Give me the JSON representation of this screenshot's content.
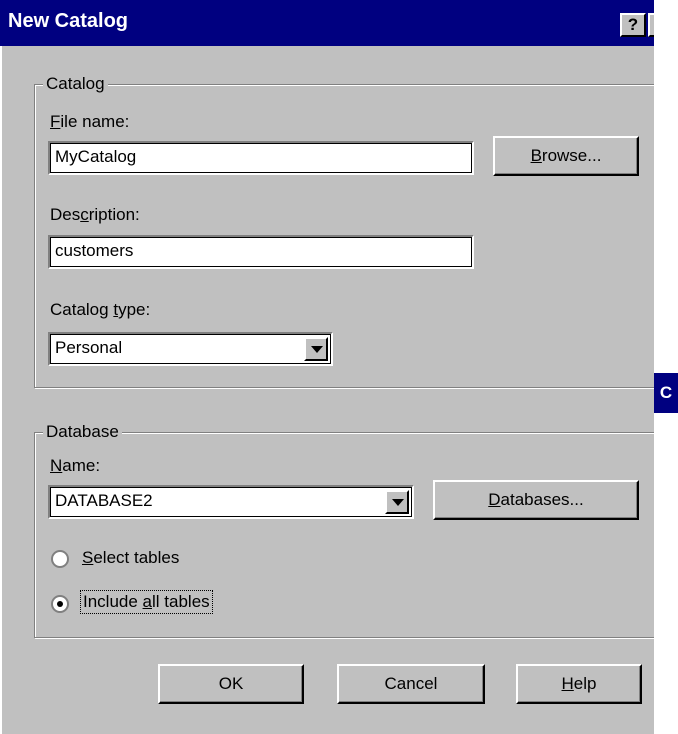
{
  "window": {
    "title": "New Catalog",
    "help_icon_glyph": "?",
    "close_icon_glyph": "✕"
  },
  "catalog_group": {
    "legend": "Catalog",
    "file_name_label": {
      "mnemonic": "F",
      "rest": "ile name:"
    },
    "file_name_value": "MyCatalog",
    "browse_button": {
      "mnemonic": "B",
      "rest": "rowse..."
    },
    "description_label": {
      "pre": "Des",
      "mnemonic": "c",
      "rest": "ription:"
    },
    "description_value": "customers",
    "catalog_type_label": {
      "pre": "Catalog ",
      "mnemonic": "t",
      "rest": "ype:"
    },
    "catalog_type_value": "Personal"
  },
  "database_group": {
    "legend": "Database",
    "name_label": {
      "mnemonic": "N",
      "rest": "ame:"
    },
    "name_value": "DATABASE2",
    "databases_button": {
      "mnemonic": "D",
      "rest": "atabases..."
    },
    "radio_select_tables": {
      "mnemonic": "S",
      "rest": "elect tables",
      "selected": false
    },
    "radio_include_all": {
      "pre": "Include ",
      "mnemonic": "a",
      "rest": "ll tables",
      "selected": true
    }
  },
  "buttons": {
    "ok": "OK",
    "cancel": "Cancel",
    "help": {
      "mnemonic": "H",
      "rest": "elp"
    }
  },
  "side_window": {
    "caption_fragment": "C"
  },
  "colors": {
    "titlebar": "#000080",
    "dialog_face": "#c0c0c0"
  }
}
